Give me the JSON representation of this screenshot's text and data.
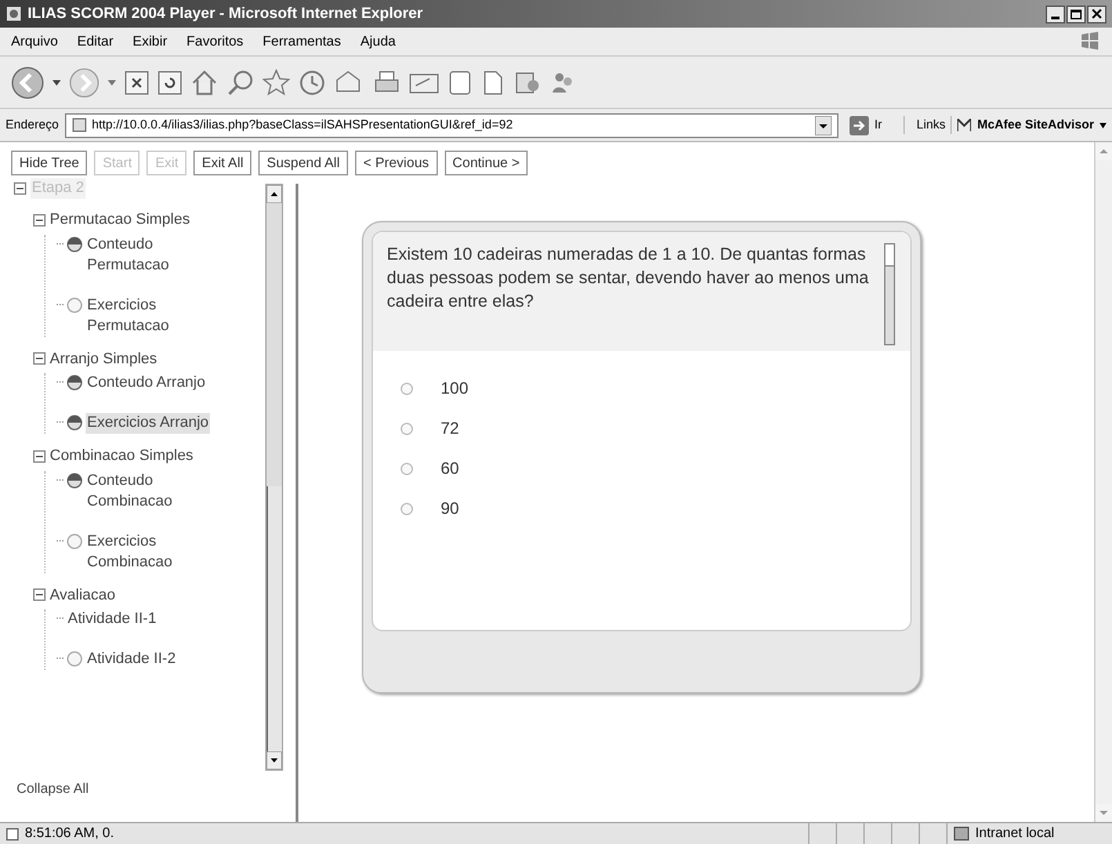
{
  "window": {
    "title": "ILIAS SCORM 2004 Player - Microsoft Internet Explorer"
  },
  "menu": [
    "Arquivo",
    "Editar",
    "Exibir",
    "Favoritos",
    "Ferramentas",
    "Ajuda"
  ],
  "address_bar": {
    "label": "Endereço",
    "value": "http://10.0.0.4/ilias3/ilias.php?baseClass=ilSAHSPresentationGUI&ref_id=92",
    "go": "Ir",
    "links": "Links",
    "addon": "McAfee SiteAdvisor"
  },
  "player_buttons": [
    {
      "label": "Hide Tree",
      "disabled": false
    },
    {
      "label": "Start",
      "disabled": true
    },
    {
      "label": "Exit",
      "disabled": true
    },
    {
      "label": "Exit All",
      "disabled": false
    },
    {
      "label": "Suspend All",
      "disabled": false
    },
    {
      "label": "< Previous",
      "disabled": false
    },
    {
      "label": "Continue >",
      "disabled": false
    }
  ],
  "tree": [
    {
      "label": "Etapa 2",
      "expanded": true,
      "dimmed": true,
      "children": [
        {
          "label": "Permutacao Simples",
          "expanded": true,
          "children": [
            {
              "label": "Conteudo Permutacao",
              "kind": "status",
              "completed": true,
              "selected": false
            },
            {
              "label": "Exercicios Permutacao",
              "kind": "status",
              "completed": false,
              "selected": false
            }
          ]
        },
        {
          "label": "Arranjo Simples",
          "expanded": true,
          "children": [
            {
              "label": "Conteudo Arranjo",
              "kind": "status",
              "completed": true,
              "selected": false
            },
            {
              "label": "Exercicios Arranjo",
              "kind": "status",
              "completed": true,
              "selected": true
            }
          ]
        },
        {
          "label": "Combinacao Simples",
          "expanded": true,
          "children": [
            {
              "label": "Conteudo Combinacao",
              "kind": "status",
              "completed": true,
              "selected": false
            },
            {
              "label": "Exercicios Combinacao",
              "kind": "status",
              "completed": false,
              "selected": false
            }
          ]
        },
        {
          "label": "Avaliacao",
          "expanded": true,
          "children": [
            {
              "label": "Atividade II-1",
              "kind": "plain",
              "selected": false
            },
            {
              "label": "Atividade II-2",
              "kind": "status",
              "completed": false,
              "selected": false
            }
          ]
        }
      ]
    }
  ],
  "collapse_all": "Collapse All",
  "question": {
    "text": "Existem 10 cadeiras numeradas de 1 a 10. De quantas formas duas pessoas podem se sentar, devendo haver ao menos uma cadeira entre elas?",
    "options": [
      {
        "label": "100",
        "selected": false
      },
      {
        "label": "72",
        "selected": false
      },
      {
        "label": "60",
        "selected": false
      },
      {
        "label": "90",
        "selected": false
      }
    ]
  },
  "status_bar": {
    "text": "8:51:06 AM, 0.",
    "zone": "Intranet local"
  }
}
